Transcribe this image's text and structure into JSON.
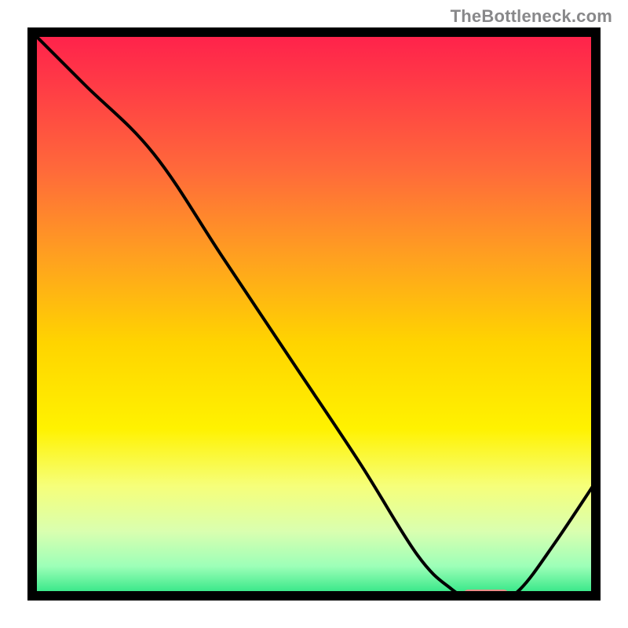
{
  "watermark": "TheBottleneck.com",
  "chart_data": {
    "type": "line",
    "title": "",
    "xlabel": "",
    "ylabel": "",
    "xlim": [
      0,
      100
    ],
    "ylim": [
      0,
      100
    ],
    "series": [
      {
        "name": "bottleneck-curve",
        "x": [
          0,
          10,
          22,
          34,
          46,
          58,
          68,
          74,
          78,
          82,
          86,
          92,
          100
        ],
        "y": [
          100,
          90,
          78,
          60,
          42,
          24,
          8,
          2,
          0,
          0,
          2,
          10,
          22
        ]
      }
    ],
    "annotations": [
      {
        "name": "optimal-marker",
        "x_start": 76,
        "x_end": 84,
        "y": 1,
        "color": "#f08a87"
      }
    ],
    "gradient_stops": [
      {
        "offset": 0.0,
        "color": "#ff1e4c"
      },
      {
        "offset": 0.1,
        "color": "#ff3b46"
      },
      {
        "offset": 0.25,
        "color": "#ff6a3a"
      },
      {
        "offset": 0.4,
        "color": "#ffa020"
      },
      {
        "offset": 0.55,
        "color": "#ffd400"
      },
      {
        "offset": 0.7,
        "color": "#fff200"
      },
      {
        "offset": 0.8,
        "color": "#f6ff7a"
      },
      {
        "offset": 0.88,
        "color": "#d9ffb0"
      },
      {
        "offset": 0.94,
        "color": "#9dffb8"
      },
      {
        "offset": 1.0,
        "color": "#18e07a"
      }
    ]
  }
}
